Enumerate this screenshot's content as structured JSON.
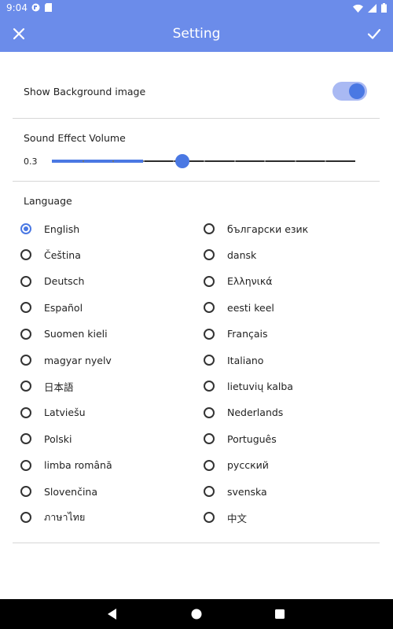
{
  "status_bar": {
    "time": "9:04",
    "left_icons": [
      "app-notification-icon",
      "sd-card-icon"
    ],
    "right_icons": [
      "wifi-icon",
      "signal-icon",
      "battery-icon"
    ]
  },
  "app_bar": {
    "title": "Setting",
    "close_icon": "close-icon",
    "confirm_icon": "check-icon",
    "color": "#6b8cea"
  },
  "background_image": {
    "label": "Show Background image",
    "enabled": true
  },
  "sound": {
    "label": "Sound Effect Volume",
    "value_text": "0.3",
    "value": 0.3,
    "divisions": 10
  },
  "language": {
    "label": "Language",
    "selected": "English",
    "left_column": [
      "English",
      "Čeština",
      "Deutsch",
      "Español",
      "Suomen kieli",
      "magyar nyelv",
      "日本語",
      "Latviešu",
      "Polski",
      "limba română",
      "Slovenčina",
      "ภาษาไทย"
    ],
    "right_column": [
      "български език",
      "dansk",
      "Ελληνικά",
      "eesti keel",
      "Français",
      "Italiano",
      "lietuvių kalba",
      "Nederlands",
      "Português",
      "русский",
      "svenska",
      "中文"
    ]
  },
  "nav_bar": {
    "back_icon": "back-triangle-icon",
    "home_icon": "home-circle-icon",
    "recents_icon": "recents-square-icon"
  },
  "colors": {
    "accent": "#4a78e3",
    "toggle_track": "#a9b9f3"
  }
}
